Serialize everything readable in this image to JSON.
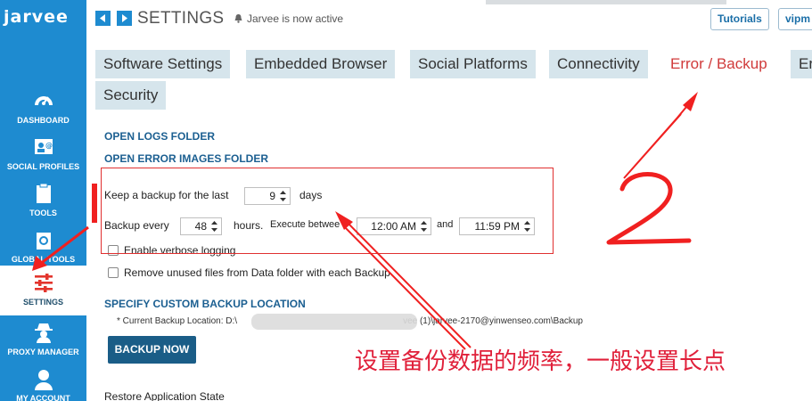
{
  "app": {
    "logo_text": "jarvee"
  },
  "sidebar": {
    "items": [
      {
        "label": "DASHBOARD",
        "icon": "dashboard-icon"
      },
      {
        "label": "SOCIAL PROFILES",
        "icon": "profile-card-icon"
      },
      {
        "label": "TOOLS",
        "icon": "clipboard-icon"
      },
      {
        "label": "GLOBAL TOOLS",
        "icon": "globe-icon"
      },
      {
        "label": "SETTINGS",
        "icon": "sliders-icon"
      },
      {
        "label": "PROXY MANAGER",
        "icon": "spy-icon"
      },
      {
        "label": "MY ACCOUNT",
        "icon": "user-icon"
      }
    ],
    "active": "SETTINGS"
  },
  "header": {
    "title": "SETTINGS",
    "status": "Jarvee is now active",
    "tutorials_label": "Tutorials",
    "vip_label": "vipm"
  },
  "tabs": [
    {
      "label": "Software Settings"
    },
    {
      "label": "Embedded Browser"
    },
    {
      "label": "Social Platforms"
    },
    {
      "label": "Connectivity"
    },
    {
      "label": "Error / Backup",
      "active": true
    },
    {
      "label": "Er"
    },
    {
      "label": "Security"
    }
  ],
  "content": {
    "open_logs": "OPEN LOGS FOLDER",
    "open_error_images": "OPEN ERROR IMAGES FOLDER",
    "keep_backup_label": "Keep a backup for the last",
    "keep_backup_days": "9",
    "days_label": "days",
    "backup_every_label": "Backup every",
    "backup_every_hours": "48",
    "hours_label": "hours.",
    "execute_between_label": "Execute betwee",
    "time_start": "12:00 AM",
    "and_label": "and",
    "time_end": "11:59 PM",
    "verbose_label": "Enable verbose logging",
    "remove_unused_label": "Remove unused files from Data folder with each Backup",
    "custom_location_title": "SPECIFY CUSTOM BACKUP LOCATION",
    "current_location_prefix": "* Current Backup Location:  D:\\",
    "current_location_suffix": "vee (1)\\jarvee-2170@yinwenseo.com\\Backup",
    "backup_now_label": "BACKUP NOW",
    "restore_label": "Restore Application State"
  },
  "annotations": {
    "number": "2",
    "chinese_text": "设置备份数据的频率，一般设置长点",
    "color": "#e0203a"
  }
}
